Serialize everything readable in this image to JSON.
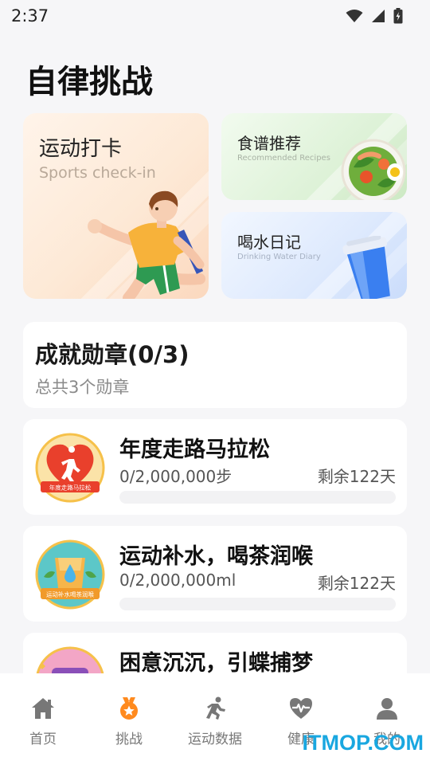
{
  "status_bar": {
    "time": "2:37"
  },
  "page_title": "自律挑战",
  "cards": {
    "sports": {
      "title": "运动打卡",
      "subtitle": "Sports check-in"
    },
    "recipe": {
      "title": "食谱推荐",
      "subtitle": "Recommended Recipes"
    },
    "water": {
      "title": "喝水日记",
      "subtitle": "Drinking Water Diary"
    }
  },
  "achievements": {
    "title": "成就勋章(0/3)",
    "subtitle": "总共3个勋章"
  },
  "medals": [
    {
      "name": "年度走路马拉松",
      "progress": "0/2,000,000步",
      "remaining": "剩余122天",
      "fill": 0,
      "badge_text": "年度走路马拉松"
    },
    {
      "name": "运动补水，喝茶润喉",
      "progress": "0/2,000,000ml",
      "remaining": "剩余122天",
      "fill": 0,
      "badge_text": "运动补水喝茶润喉"
    },
    {
      "name": "困意沉沉，引蝶捕梦",
      "progress": "",
      "remaining": "",
      "fill": 0
    }
  ],
  "tabbar": [
    {
      "label": "首页",
      "icon": "home-icon"
    },
    {
      "label": "挑战",
      "icon": "medal-icon",
      "active": true
    },
    {
      "label": "运动数据",
      "icon": "running-icon"
    },
    {
      "label": "健康",
      "icon": "heart-pulse-icon"
    },
    {
      "label": "我的",
      "icon": "user-icon"
    }
  ],
  "watermark": "ITMOP.COM",
  "colors": {
    "accent": "#ff8a1e",
    "inactive_icon": "#777777",
    "background": "#f6f6f8"
  }
}
